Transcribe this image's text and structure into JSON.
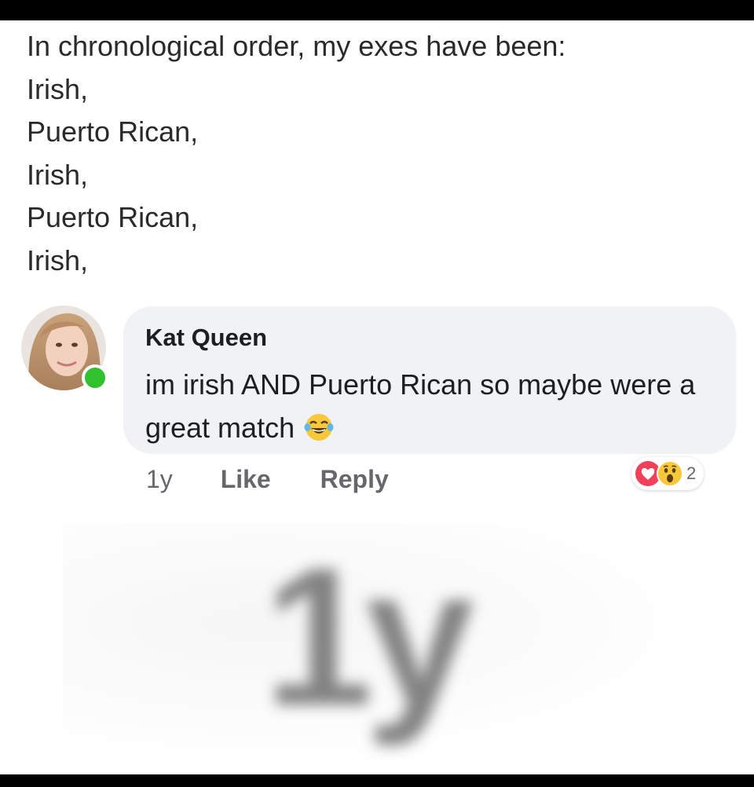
{
  "post": {
    "lines": [
      "In chronological order, my exes have been:",
      "Irish,",
      "Puerto Rican,",
      "Irish,",
      "Puerto Rican,",
      "Irish,"
    ]
  },
  "comment": {
    "author": "Kat Queen",
    "text": "im irish AND Puerto Rican so maybe were a great match",
    "emoji_icon": "laughing-crying-emoji",
    "online": true,
    "online_color": "#31c02e",
    "bubble_color": "#f0f2f5"
  },
  "actions": {
    "time": "1y",
    "like": "Like",
    "reply": "Reply"
  },
  "reactions": {
    "icons": [
      "love-reaction-icon",
      "wow-reaction-icon"
    ],
    "count": "2"
  },
  "overlay": {
    "zoomed_time": "1y"
  }
}
